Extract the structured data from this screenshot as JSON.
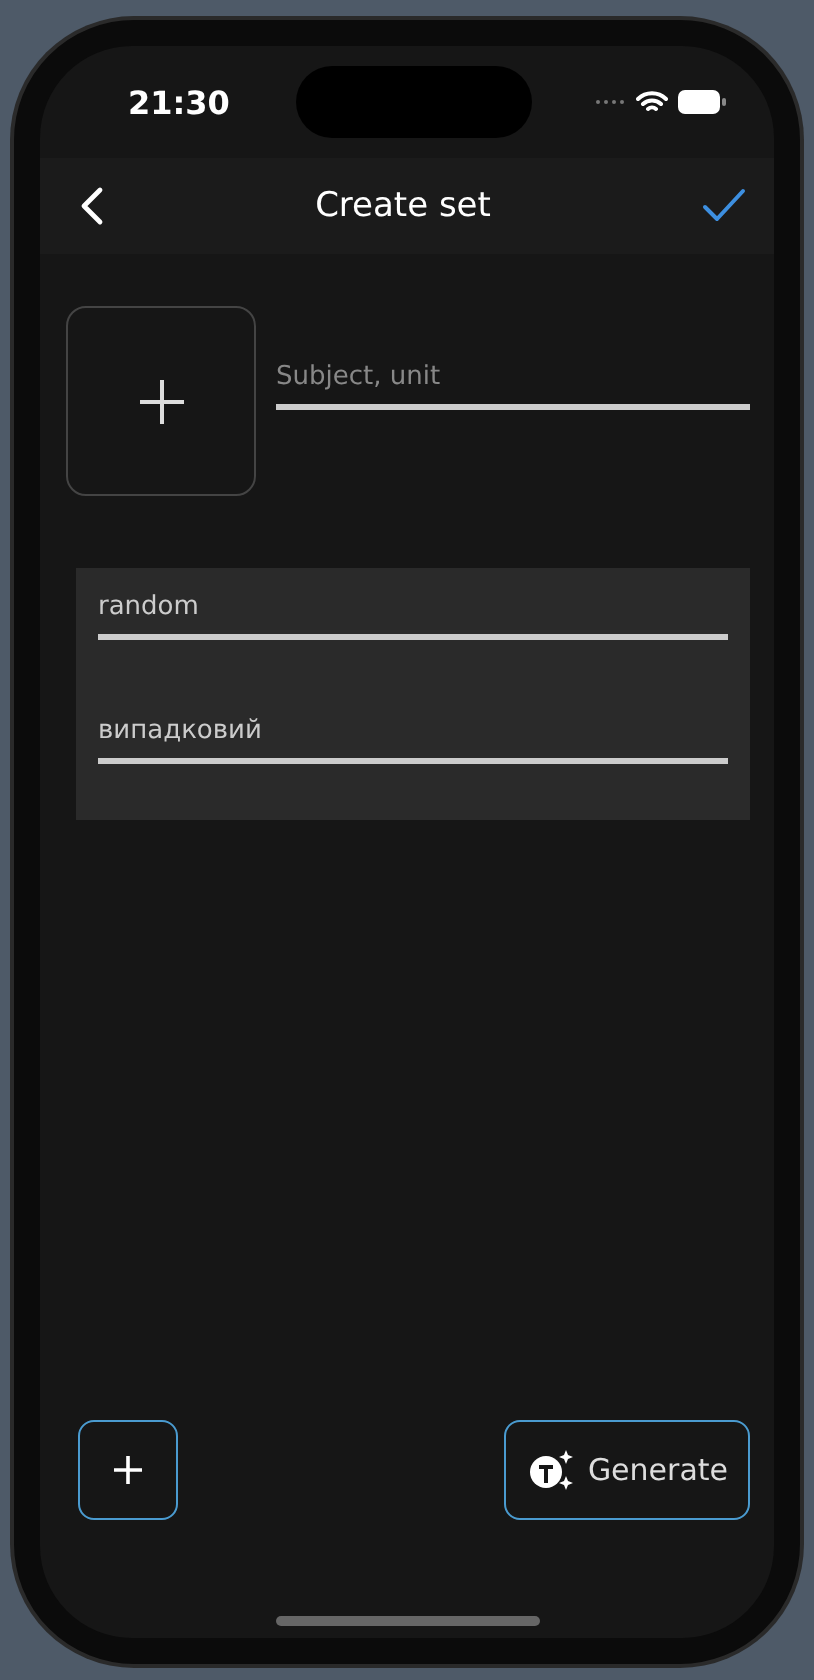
{
  "status_bar": {
    "time": "21:30"
  },
  "header": {
    "title": "Create set"
  },
  "subject_field": {
    "placeholder": "Subject, unit"
  },
  "card": {
    "fields": [
      {
        "value": "random"
      },
      {
        "value": "випадковий"
      }
    ]
  },
  "footer": {
    "generate_label": "Generate"
  }
}
